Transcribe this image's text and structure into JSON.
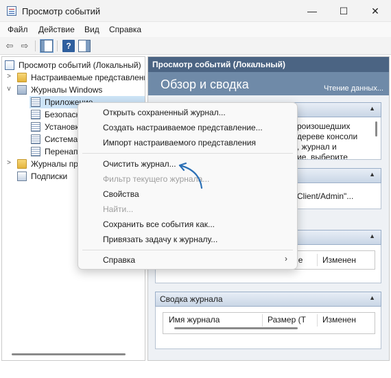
{
  "window": {
    "title": "Просмотр событий",
    "controls": {
      "minimize": "—",
      "maximize": "☐",
      "close": "✕"
    }
  },
  "menu": [
    "Файл",
    "Действие",
    "Вид",
    "Справка"
  ],
  "toolbar": {
    "back_icon": "arrow-left-icon",
    "forward_icon": "arrow-right-icon",
    "back": "⇦",
    "forward": "⇨",
    "help": "?"
  },
  "tree": {
    "root": "Просмотр событий (Локальный)",
    "custom_views": "Настраиваемые представления",
    "windows_logs": "Журналы Windows",
    "application": "Приложение",
    "security": "Безопасность",
    "setup": "Установка",
    "system": "Система",
    "forwarded": "Перенаправленные события",
    "apps_services": "Журналы приложений и служб",
    "subscriptions": "Подписки"
  },
  "right_pane": {
    "header": "Просмотр событий (Локальный)",
    "banner_title": "Обзор и сводка",
    "banner_sub": "Чтение данных...",
    "section1_text": [
      "роизошедших",
      "дереве консоли",
      ", журнал и",
      "ие, выберите"
    ],
    "section2_text": "Client/Admin\"...",
    "grid1": {
      "col1": "ие",
      "col2": "Изменен"
    },
    "log_summary": {
      "title": "Сводка журнала",
      "col_name": "Имя журнала",
      "col_size": "Размер (Т",
      "col_modified": "Изменен"
    }
  },
  "context_menu": {
    "open_saved": "Открыть сохраненный журнал...",
    "create_view": "Создать настраиваемое представление...",
    "import_view": "Импорт настраиваемого представления",
    "clear_log": "Очистить журнал...",
    "filter_log": "Фильтр текущего журнала...",
    "properties": "Свойства",
    "find": "Найти...",
    "save_all": "Сохранить все события как...",
    "attach_task": "Привязать задачу к журналу...",
    "help": "Справка",
    "submenu_arrow": "›"
  },
  "colors": {
    "header_bg": "#4b6483",
    "banner_bg": "#6f8aa8",
    "selection": "#cde4f7",
    "annotation_arrow": "#2a6fb5"
  }
}
